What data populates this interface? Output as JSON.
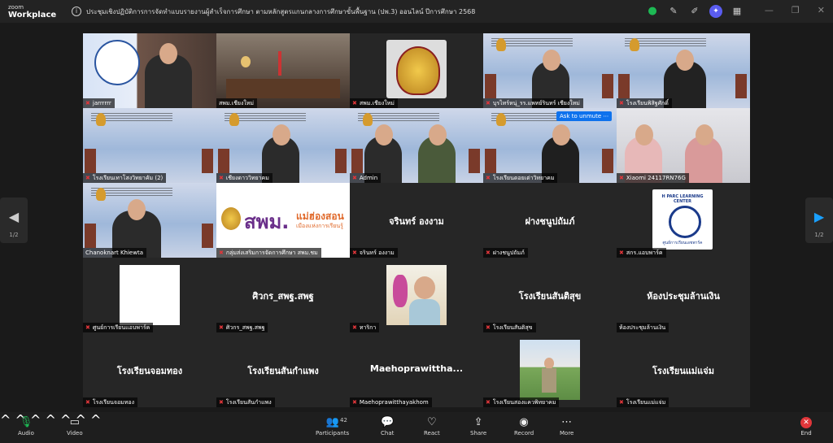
{
  "app": {
    "brand_top": "zoom",
    "brand_bottom": "Workplace"
  },
  "meeting": {
    "title": "ประชุมเชิงปฏิบัติการการจัดทำแบบรายงานผู้สำเร็จการศึกษา ตามหลักสูตรแกนกลางการศึกษาขั้นพื้นฐาน (ปพ.3) ออนไลน์ ปีการศึกษา 2568"
  },
  "titlebar_icons": [
    "shield-icon",
    "notes-icon",
    "whiteboard-icon",
    "ai-companion-icon",
    "apps-icon"
  ],
  "pager": {
    "left_count": "1/2",
    "right_count": "1/2"
  },
  "unmute_label": "Ask to unmute",
  "tiles": [
    {
      "name": "jarrrrrr"
    },
    {
      "name": "สพม.เชียงใหม่"
    },
    {
      "name": "สพม.เชียงใหม่"
    },
    {
      "name": "บุรไทร์หนุ่_รร.แพทย์รินทร์ เชียงใหม่"
    },
    {
      "name": "โรงเรียนพิสิฐศักดิ์"
    },
    {
      "name": "โรงเรียนเทาโสงวิทยาคัม (2)"
    },
    {
      "name": "เชียงดาววิทยาคม"
    },
    {
      "name": "Admin"
    },
    {
      "name": "โรงเรียนดอยเต่าวิทยาคม"
    },
    {
      "name": "Xiaomi 24117RN76G"
    },
    {
      "name": "Chanoknart Khiewta"
    },
    {
      "name": "กลุ่มส่งเสริมการจัดการศึกษา สพม.ชม"
    },
    {
      "name": "จรินทร์ องงาม",
      "center": "จรินทร์ องงาม"
    },
    {
      "name": "ฝางชนูปถัมภ์",
      "center": "ฝางชนูปถัมภ์"
    },
    {
      "name": "สกร.แอบพาร์ค"
    },
    {
      "name": "ศูนย์การเรียนแอบพาร์ค"
    },
    {
      "name": "ศิวกร_สพฐ.สพฐ",
      "center": "ศิวกร_สพฐ.สพฐ"
    },
    {
      "name": "ทาริกา"
    },
    {
      "name": "โรงเรียนสันติสุข",
      "center": "โรงเรียนสันติสุข"
    },
    {
      "name": "ห้องประชุมล้านเงิน",
      "center": "ห้องประชุมล้านเงิน"
    },
    {
      "name": "โรงเรียนจอมทอง",
      "center": "โรงเรียนจอมทอง"
    },
    {
      "name": "โรงเรียนสันกำแพง",
      "center": "โรงเรียนสันกำแพง"
    },
    {
      "name": "Maehoprawitthayakhom",
      "center": "Maehoprawittha..."
    },
    {
      "name": "โรงเรียนสองแควพิทยาคม"
    },
    {
      "name": "โรงเรียนแม่แจ่ม",
      "center": "โรงเรียนแม่แจ่ม"
    }
  ],
  "logo_texts": {
    "spm": "สพม.",
    "spm_sub": "แม่ฮ่องสอน",
    "spm_tag": "เมืองแห่งการเรียนรู้",
    "hparc": "H PARC LEARNING CENTER",
    "hparc_sub": "ศูนย์การเรียนเอชพาร์ค"
  },
  "toolbar": {
    "audio": "Audio",
    "video": "Video",
    "participants": "Participants",
    "participants_count": "42",
    "chat": "Chat",
    "react": "React",
    "share": "Share",
    "record": "Record",
    "more": "More",
    "end": "End"
  },
  "colors": {
    "accent": "#0e72ed",
    "active_speaker": "#23c163",
    "end": "#e0363a",
    "muted": "#e0363a"
  }
}
